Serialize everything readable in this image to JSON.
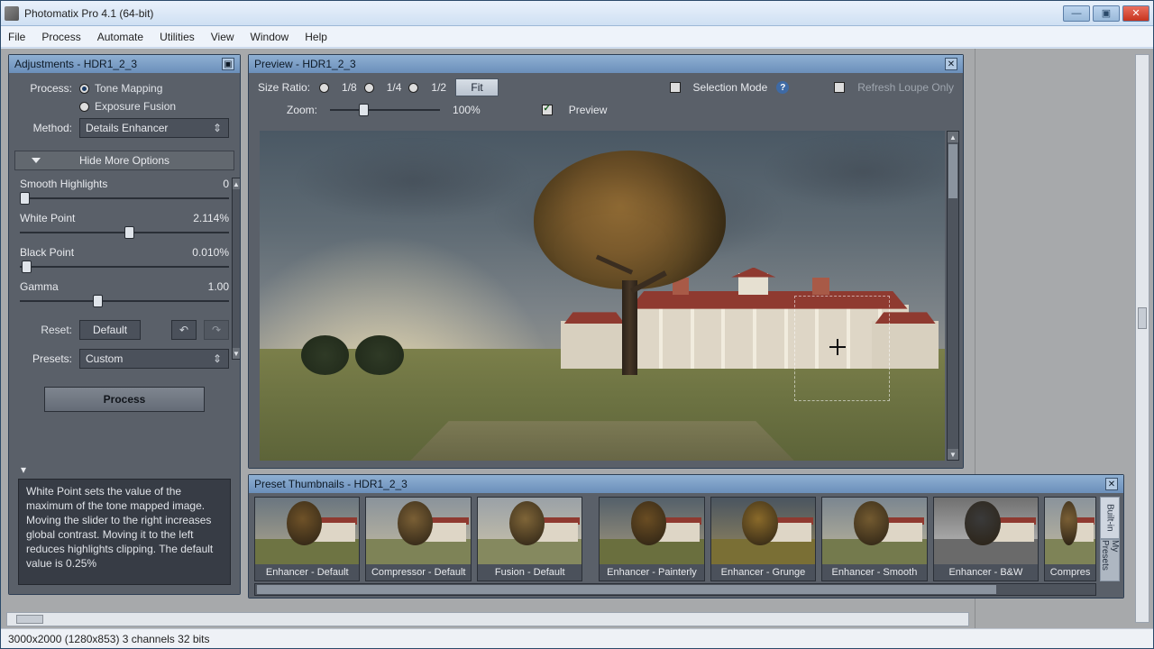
{
  "window": {
    "title": "Photomatix Pro 4.1 (64-bit)"
  },
  "menu": {
    "file": "File",
    "process": "Process",
    "automate": "Automate",
    "utilities": "Utilities",
    "view": "View",
    "window": "Window",
    "help": "Help"
  },
  "adj": {
    "panel_title": "Adjustments - HDR1_2_3",
    "process_label": "Process:",
    "process_tone": "Tone Mapping",
    "process_exp": "Exposure Fusion",
    "method_label": "Method:",
    "method_value": "Details Enhancer",
    "toggle_label": "Hide More Options",
    "sliders": {
      "smooth": {
        "label": "Smooth Highlights",
        "value": "0",
        "pos": 0
      },
      "white": {
        "label": "White Point",
        "value": "2.114%",
        "pos": 50
      },
      "black": {
        "label": "Black Point",
        "value": "0.010%",
        "pos": 1
      },
      "gamma": {
        "label": "Gamma",
        "value": "1.00",
        "pos": 35
      }
    },
    "reset_label": "Reset:",
    "default_btn": "Default",
    "presets_label": "Presets:",
    "presets_value": "Custom",
    "process_btn": "Process",
    "help_text": "White Point sets the value of the maximum of the tone mapped image. Moving the slider to the right increases global contrast. Moving it to the left reduces highlights clipping. The default value is 0.25%"
  },
  "preview": {
    "panel_title": "Preview - HDR1_2_3",
    "size_ratio_label": "Size Ratio:",
    "r8": "1/8",
    "r4": "1/4",
    "r2": "1/2",
    "fit": "Fit",
    "selection_mode": "Selection Mode",
    "refresh": "Refresh Loupe Only",
    "zoom_label": "Zoom:",
    "zoom_value": "100%",
    "preview_ck": "Preview"
  },
  "presets_panel": {
    "panel_title": "Preset Thumbnails - HDR1_2_3",
    "tabs": {
      "builtin": "Built-in",
      "mine": "My Presets"
    },
    "items": [
      {
        "label": "Enhancer - Default",
        "style": "default"
      },
      {
        "label": "Compressor - Default",
        "style": "compressor"
      },
      {
        "label": "Fusion - Default",
        "style": "fusion"
      },
      {
        "label": "Enhancer - Painterly",
        "style": "painterly"
      },
      {
        "label": "Enhancer - Grunge",
        "style": "grunge"
      },
      {
        "label": "Enhancer - Smooth",
        "style": "smooth"
      },
      {
        "label": "Enhancer - B&W",
        "style": "bw"
      },
      {
        "label": "Compres",
        "style": "cut"
      }
    ]
  },
  "status": "3000x2000 (1280x853) 3 channels 32 bits"
}
